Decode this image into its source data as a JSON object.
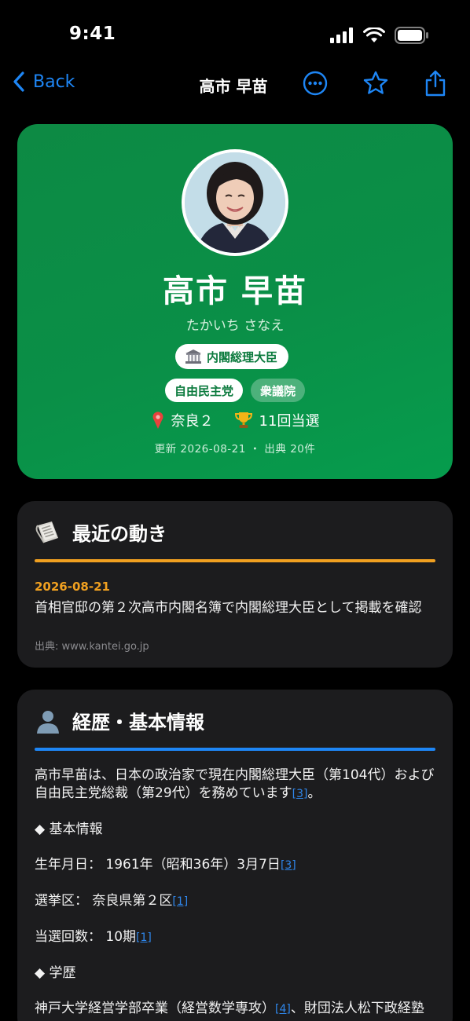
{
  "status_bar": {
    "time": "9:41"
  },
  "nav": {
    "back_label": "Back",
    "title": "高市 早苗"
  },
  "hero": {
    "name": "高市 早苗",
    "kana": "たかいち さなえ",
    "role": "内閣総理大臣",
    "party": "自由民主党",
    "house": "衆議院",
    "district": "奈良２",
    "elections": "11回当選",
    "meta": "更新 2026-08-21 ・ 出典 20件",
    "colors": {
      "card": "#0a8f47",
      "chip_text": "#0b7a3d"
    }
  },
  "news": {
    "title": "最近の動き",
    "accent": "#f0a020",
    "date": "2026-08-21",
    "text": "首相官邸の第２次高市内閣名簿で内閣総理大臣として掲載を確認",
    "source": "出典: www.kantei.go.jp"
  },
  "bio": {
    "title": "経歴・基本情報",
    "accent": "#1e86f5",
    "intro": "高市早苗は、日本の政治家で現在内閣総理大臣（第104代）および自由民主党総裁（第29代）を務めています",
    "intro_ref": "[3]",
    "intro_end": "。",
    "basic_heading": "◆ 基本情報",
    "birth_label": "生年月日： 1961年（昭和36年）3月7日",
    "birth_ref": "[3]",
    "district_label": "選挙区： 奈良県第２区",
    "district_ref": "[1]",
    "terms_label": "当選回数： 10期",
    "terms_ref": "[1]",
    "edu_heading": "◆ 学歴",
    "edu_text": "神戸大学経営学部卒業（経営数学専攻）",
    "edu_ref": "[4]",
    "edu_text2": "、財団法人松下政経塾"
  }
}
